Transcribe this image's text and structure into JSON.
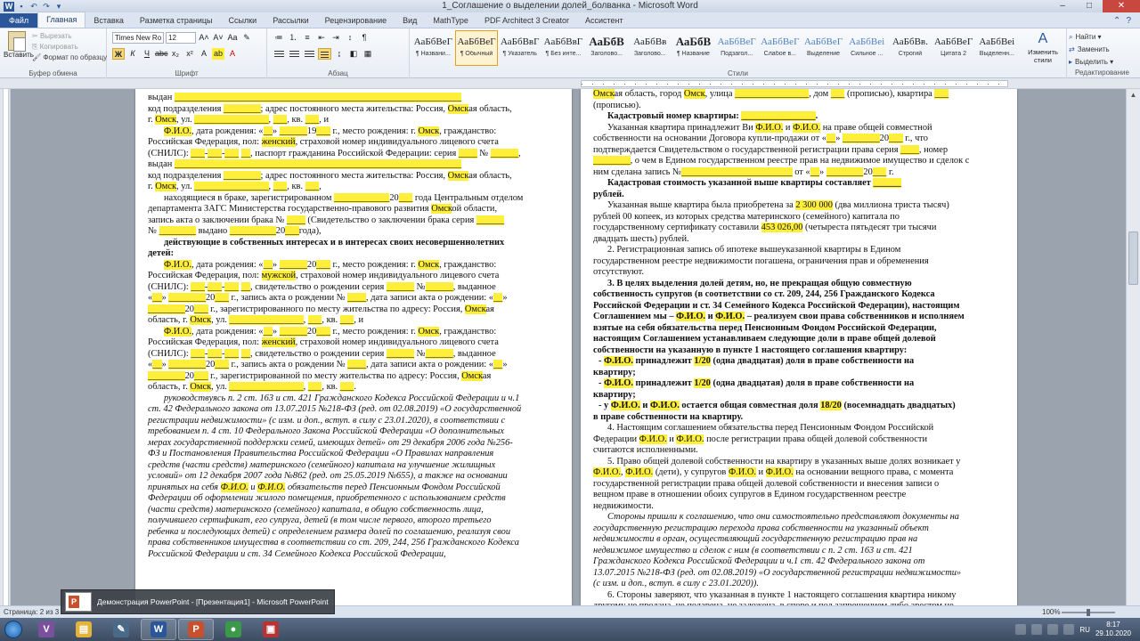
{
  "window": {
    "title": "1_Соглашение о выделении долей_болванка - Microsoft Word",
    "app_icon": "W",
    "controls": {
      "minimize": "–",
      "maximize": "□",
      "close": "✕"
    }
  },
  "tabs": [
    "Файл",
    "Главная",
    "Вставка",
    "Разметка страницы",
    "Ссылки",
    "Рассылки",
    "Рецензирование",
    "Вид",
    "MathType",
    "PDF Architect 3 Creator",
    "Ассистент"
  ],
  "active_tab": "Главная",
  "ribbon": {
    "clipboard": {
      "paste": "Вставить",
      "cut": "Вырезать",
      "copy": "Копировать",
      "format_painter": "Формат по образцу",
      "group": "Буфер обмена"
    },
    "font": {
      "name": "Times New Ro",
      "size": "12",
      "group": "Шрифт"
    },
    "paragraph": {
      "group": "Абзац"
    },
    "styles": {
      "group": "Стили",
      "items": [
        {
          "sample": "АаБбВеГ",
          "name": "¶ Названи..."
        },
        {
          "sample": "АаБбВеГ",
          "name": "¶ Обычный"
        },
        {
          "sample": "АаБбВвГ",
          "name": "¶ Указатель"
        },
        {
          "sample": "АаБбВвГ",
          "name": "¶ Без инте..."
        },
        {
          "sample": "АаБбВ",
          "name": "Заголово..."
        },
        {
          "sample": "АаБбВв",
          "name": "Заголово..."
        },
        {
          "sample": "АаБбВ",
          "name": "¶ Название"
        },
        {
          "sample": "АаБбВеГ",
          "name": "Подзагол..."
        },
        {
          "sample": "АаБбВеГ",
          "name": "Слабое в..."
        },
        {
          "sample": "АаБбВеГ",
          "name": "Выделение"
        },
        {
          "sample": "АаБбВеі",
          "name": "Сильное ..."
        },
        {
          "sample": "АаБбВв.",
          "name": "Строгий"
        },
        {
          "sample": "АаБбВеГ",
          "name": "Цитата 2"
        },
        {
          "sample": "АаБбВеі",
          "name": "Выделенн..."
        }
      ],
      "change": "Изменить стили"
    },
    "editing": {
      "find": "Найти",
      "replace": "Заменить",
      "select": "Выделить",
      "group": "Редактирование"
    }
  },
  "left_page": [
    {
      "t": "выдан ______________________________________________________________"
    },
    {
      "t": "код подразделения ________; адрес постоянного места жительства: Россия, Омская область,"
    },
    {
      "t": "г. Омск, ул. ________________, ___, кв. ___, и"
    },
    {
      "t": "Ф.И.О., дата рождения: «__» ______19___ г., место рождения: г. Омск, гражданство:"
    },
    {
      "t": "Российская Федерация, пол: женский, страховой номер индивидуального лицевого счета"
    },
    {
      "t": "(СНИЛС): ___-___-___ __, паспорт гражданина Российской Федерации: серия ____ № ______,"
    },
    {
      "t": "выдан ______________________________________________________________"
    },
    {
      "t": "код подразделения ________; адрес постоянного места жительства: Россия, Омская область,"
    },
    {
      "t": "г. Омск, ул. ________________, ___, кв. ___,"
    },
    {
      "t": "находящиеся в браке, зарегистрированном ____________20___ года Центральным отделом"
    },
    {
      "t": "департамента ЗАГС Министерства государственно-правового развития Омской области,"
    },
    {
      "t": "запись акта о заключении брака № ____ (Свидетельство о заключении брака серия ______"
    },
    {
      "t": "№ ________ выдано __________20___года),"
    },
    {
      "t": "действующие в собственных интересах и в интересах своих несовершеннолетних"
    },
    {
      "t": "детей:"
    },
    {
      "t": "Ф.И.О., дата рождения: «__» ______20___ г., место рождения: г. Омск, гражданство:"
    },
    {
      "t": "Российская Федерация, пол: мужской, страховой номер индивидуального лицевого счета"
    },
    {
      "t": "(СНИЛС): ___-___-___ __, свидетельство о рождении серия ______ №______, выданное"
    },
    {
      "t": "«__» ________20___ г., запись акта о рождении № ____, дата записи акта о рождении: «__»"
    },
    {
      "t": "________20___ г., зарегистрированного по месту жительства по адресу: Россия, Омская"
    },
    {
      "t": "область, г. Омск, ул. ________________, ___, кв. ___, и"
    },
    {
      "t": "Ф.И.О., дата рождения: «__» ______20___ г., место рождения: г. Омск, гражданство:"
    },
    {
      "t": "Российская Федерация, пол: женский, страховой номер индивидуального лицевого счета"
    },
    {
      "t": "(СНИЛС): ___-___-___ __, свидетельство о рождении серия ______ №______, выданное"
    },
    {
      "t": "«__» ________20___ г., запись акта о рождении № ____, дата записи акта о рождении: «__»"
    },
    {
      "t": "________20___ г., зарегистрированной по месту жительства по адресу: Россия, Омская"
    },
    {
      "t": "область, г. Омск, ул. ________________, ___, кв. ___."
    },
    {
      "t": "руководствуясь п. 2 ст. 163 и ст. 421 Гражданского Кодекса Российской Федерации и ч.1"
    },
    {
      "t": "ст. 42 Федерального закона от 13.07.2015 №218-ФЗ (ред. от 02.08.2019) «О государственной"
    },
    {
      "t": "регистрации недвижимости» (с изм. и доп., вступ. в силу с 23.01.2020), в соответствии с"
    },
    {
      "t": "требованием п. 4 ст. 10 Федерального Закона Российской Федерации «О дополнительных"
    },
    {
      "t": "мерах государственной поддержки семей, имеющих детей» от 29 декабря 2006 года №256-"
    },
    {
      "t": "ФЗ и Постановления Правительства Российской Федерации «О Правилах направления"
    },
    {
      "t": "средств (части средств) материнского (семейного) капитала на улучшение жилищных"
    },
    {
      "t": "условий» от 12 декабря 2007 года №862 (ред. от 25.05.2019 №655), а также на основании"
    },
    {
      "t": "принятых на себя Ф.И.О. и Ф.И.О. обязательств перед Пенсионным Фондом Российской"
    },
    {
      "t": "Федерации об оформлении жилого помещения, приобретенного с использованием средств"
    },
    {
      "t": "(части средств) материнского (семейного) капитала, в общую собственность лица,"
    },
    {
      "t": "получившего сертификат, его супруга, детей (в том числе первого, второго третьего"
    },
    {
      "t": "ребенка и последующих детей) с определением размера долей по соглашению, реализуя свои"
    },
    {
      "t": "права собственников имущества в соответствии со ст. 209, 244, 256 Гражданского Кодекса"
    },
    {
      "t": "Российской Федерации и ст. 34 Семейного Кодекса Российской Федерации,"
    }
  ],
  "right_page": [
    {
      "t": "Омская область, город Омск, улица ________________, дом ___ (прописью), квартира ___"
    },
    {
      "t": "(прописью)."
    },
    {
      "t": "Кадастровый номер квартиры: ________________."
    },
    {
      "t": "Указанная квартира принадлежит Ви Ф.И.О. и Ф.И.О. на праве общей совместной"
    },
    {
      "t": "собственности на основании Договора купли-продажи от «__» ________20___ г., что"
    },
    {
      "t": "подтверждается Свидетельством о государственной регистрации права серия ____, номер"
    },
    {
      "t": "________, о чем в Едином государственном реестре прав на недвижимое имущество и сделок с"
    },
    {
      "t": "ним сделана запись №________________________ от «__» ________20___ г."
    },
    {
      "t": "Кадастровая стоимость указанной выше квартиры составляет ______"
    },
    {
      "t": "рублей."
    },
    {
      "t": "Указанная выше квартира была приобретена за 2 300 000 (два миллиона триста тысяч)"
    },
    {
      "t": "рублей 00 копеек, из которых средства материнского (семейного) капитала по"
    },
    {
      "t": "государственному сертификату составили 453 026,00 (четыреста пятьдесят три тысячи"
    },
    {
      "t": "двадцать шесть) рублей."
    },
    {
      "t": "2. Регистрационная запись об ипотеке вышеуказанной квартиры в Едином"
    },
    {
      "t": "государственном реестре недвижимости погашена, ограничения прав и обременения"
    },
    {
      "t": "отсутствуют."
    },
    {
      "t": "3. В целях выделения долей детям, но, не прекращая общую совместную"
    },
    {
      "t": "собственность супругов (в соответствии со ст. 209, 244, 256 Гражданского Кодекса"
    },
    {
      "t": "Российской Федерации и ст. 34 Семейного Кодекса Российской Федерации), настоящим"
    },
    {
      "t": "Соглашением мы – Ф.И.О. и Ф.И.О. – реализуем свои права собственников и исполняем"
    },
    {
      "t": "взятые на себя обязательства перед Пенсионным Фондом Российской Федерации,"
    },
    {
      "t": "настоящим Соглашением устанавливаем следующие доли в праве общей долевой"
    },
    {
      "t": "собственности на указанную в пункте 1 настоящего соглашения квартиру:"
    },
    {
      "t": "- Ф.И.О. принадлежит 1/20 (одна двадцатая) доля в праве собственности на"
    },
    {
      "t": "квартиру;"
    },
    {
      "t": "- Ф.И.О. принадлежит 1/20 (одна двадцатая) доля в праве собственности на"
    },
    {
      "t": "квартиру;"
    },
    {
      "t": "- у Ф.И.О. и Ф.И.О. остается общая совместная доля 18/20 (восемнадцать двадцатых)"
    },
    {
      "t": "в праве собственности на квартиру."
    },
    {
      "t": "4. Настоящим соглашением обязательства перед Пенсионным Фондом Российской"
    },
    {
      "t": "Федерации Ф.И.О. и Ф.И.О. после регистрации права общей долевой собственности"
    },
    {
      "t": "считаются исполненными."
    },
    {
      "t": "5. Право общей долевой собственности на квартиру в указанных выше долях возникает у"
    },
    {
      "t": "Ф.И.О., Ф.И.О. (дети), у супругов Ф.И.О. и Ф.И.О. на основании вещного права, с момента"
    },
    {
      "t": "государственной регистрации права общей долевой собственности и внесения записи о"
    },
    {
      "t": "вещном праве в отношении обоих супругов в Едином государственном реестре"
    },
    {
      "t": "недвижимости."
    },
    {
      "t": "Стороны пришли к соглашению, что они самостоятельно представляют документы на"
    },
    {
      "t": "государственную регистрацию перехода права собственности на указанный объект"
    },
    {
      "t": "недвижимости в орган, осуществляющий государственную регистрацию прав на"
    },
    {
      "t": "недвижимое имущество и сделок с ним (в соответствии с п. 2 ст. 163 и ст. 421"
    },
    {
      "t": "Гражданского Кодекса Российской Федерации и ч.1 ст. 42 Федерального закона от"
    },
    {
      "t": "13.07.2015 №218-ФЗ (ред. от 02.08.2019) «О государственной регистрации недвижимости»"
    },
    {
      "t": "(с изм. и доп., вступ. в силу с 23.01.2020))."
    },
    {
      "t": "6. Стороны заверяют, что указанная в пункте 1 настоящего соглашения квартира никому"
    },
    {
      "t": "другому не продана, не подарена, не заложена, в споре и под запрещением либо арестом не"
    }
  ],
  "status": {
    "page": "Страница: 2 из 3",
    "zoom": "100%"
  },
  "ppt_popup": "Демонстрация PowerPoint - [Презентация1] - Microsoft PowerPoint",
  "taskbar": {
    "apps": [
      {
        "name": "viber",
        "label": "V",
        "color": "#7b519d"
      },
      {
        "name": "explorer",
        "label": "▤",
        "color": "#e2b43a"
      },
      {
        "name": "tool",
        "label": "✎",
        "color": "#4a6a8a"
      },
      {
        "name": "word",
        "label": "W",
        "color": "#2b579a"
      },
      {
        "name": "powerpoint",
        "label": "P",
        "color": "#c8502c"
      },
      {
        "name": "chrome",
        "label": "●",
        "color": "#3a9a4a"
      },
      {
        "name": "screen",
        "label": "▣",
        "color": "#b83434"
      }
    ],
    "lang": "RU",
    "time": "8:17",
    "date": "29.10.2020"
  }
}
